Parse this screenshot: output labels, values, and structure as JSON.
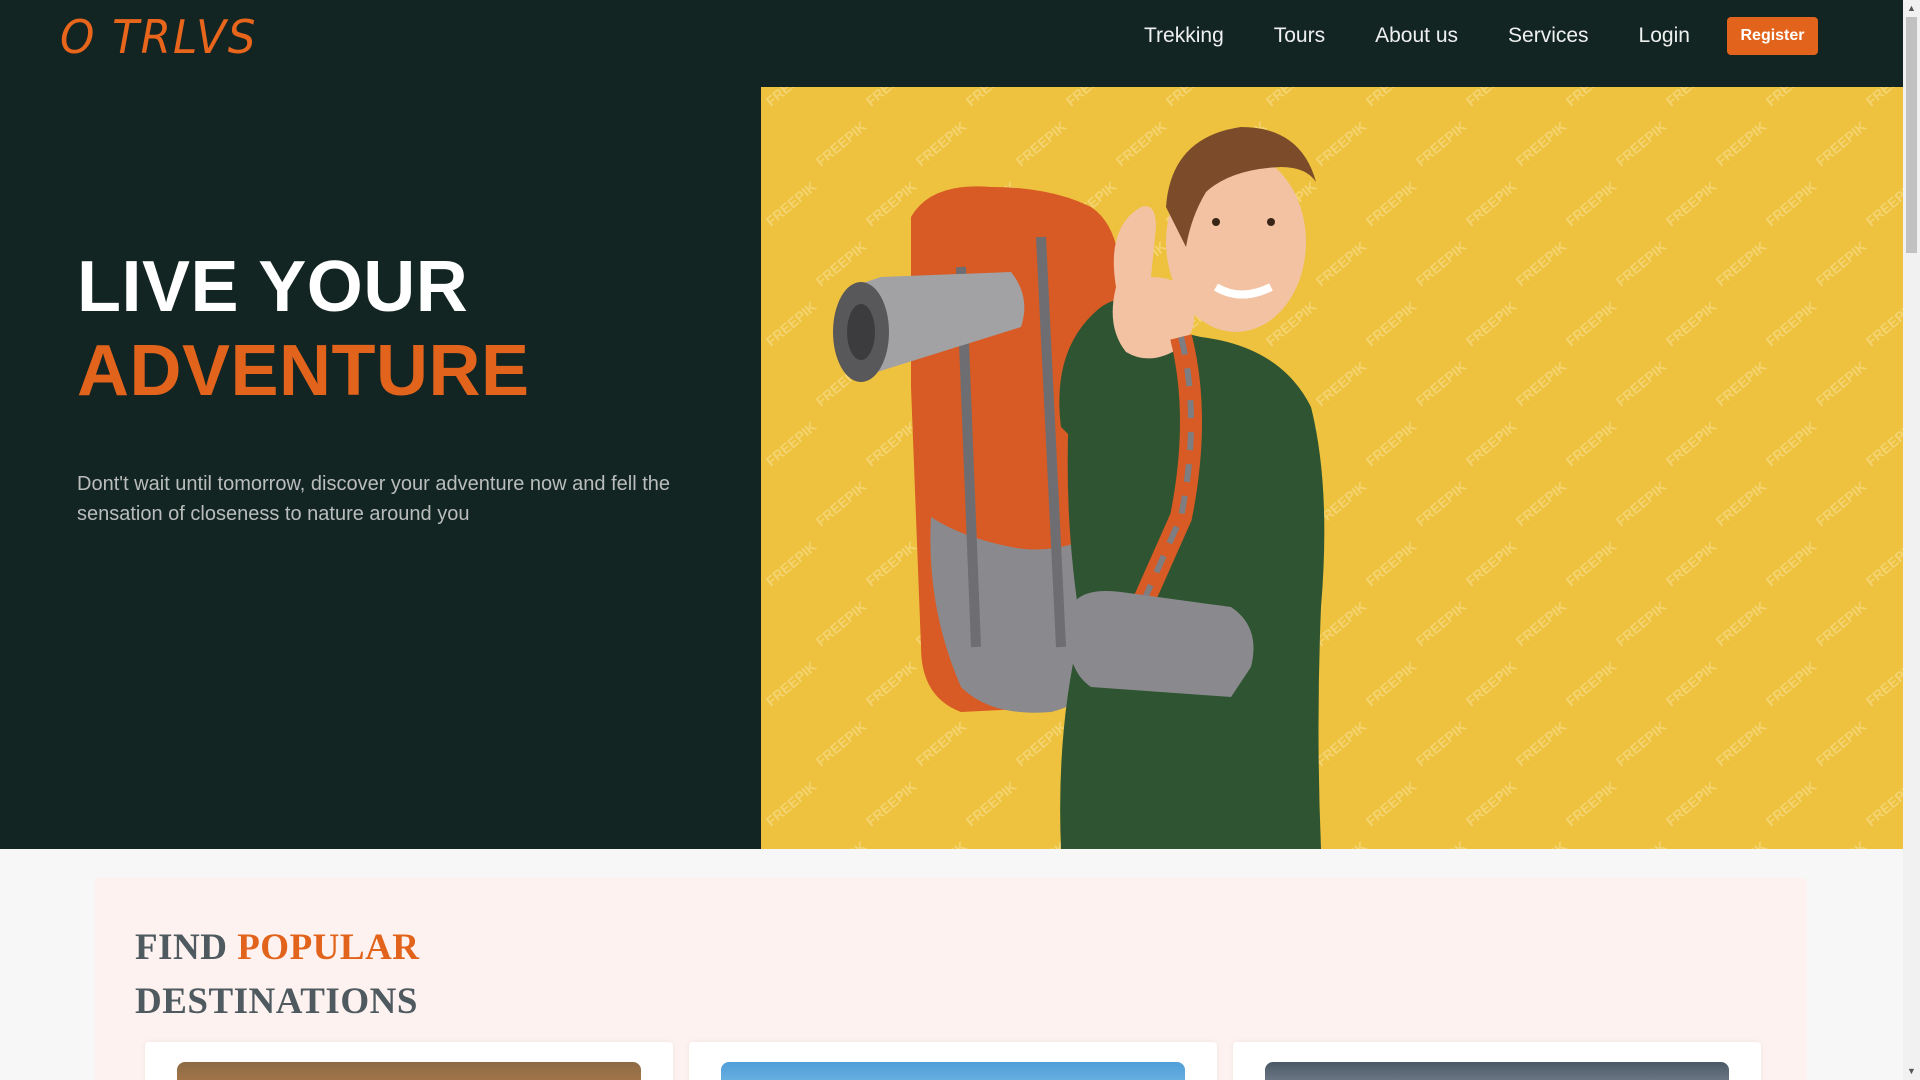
{
  "header": {
    "logo": "O TRLVS",
    "nav": [
      "Trekking",
      "Tours",
      "About us",
      "Services",
      "Login"
    ],
    "register_label": "Register"
  },
  "hero": {
    "title_line1": "LIVE YOUR",
    "title_line2": "ADVENTURE",
    "description": "Dont't wait until tomorrow, discover your adventure now and fell the sensation of closeness to nature around you",
    "image_watermark": "FREEPIK"
  },
  "destinations": {
    "title_word1": "FIND",
    "title_word2": "POPULAR",
    "title_line2": "DESTINATIONS",
    "cards": [
      "destination-1",
      "destination-2",
      "destination-3"
    ]
  },
  "colors": {
    "dark": "#132523",
    "accent": "#e2631b",
    "hero_bg": "#eec23e",
    "section_bg": "#fdf2ef"
  }
}
